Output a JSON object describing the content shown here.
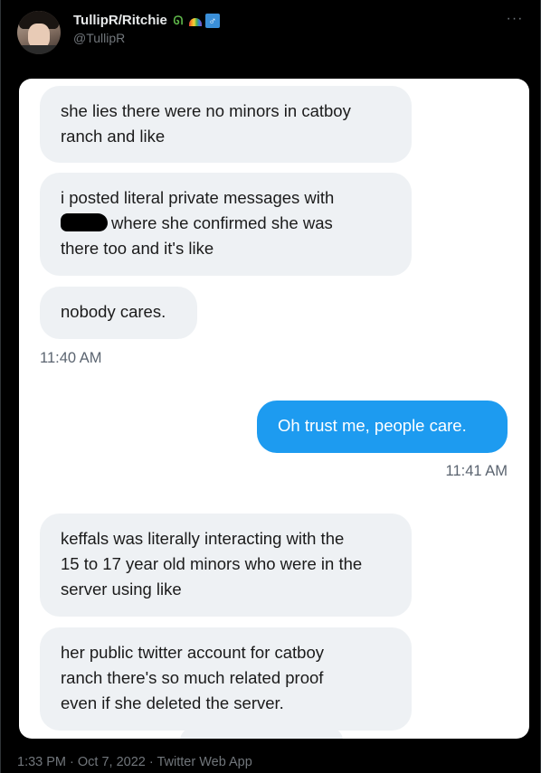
{
  "author": {
    "display_name": "TullipR/Ritchie",
    "handle": "@TullipR",
    "emojis": [
      "lizard-emoji",
      "rainbow-emoji",
      "male-sign-emoji"
    ]
  },
  "messages": [
    {
      "id": "m1",
      "text": "she lies there were no minors in catboy\nranch and like",
      "direction": "received"
    },
    {
      "id": "m2",
      "line1": "i posted literal private messages with",
      "line2_after_redaction": "where she confirmed she was",
      "line3": "there too and it's like",
      "direction": "received"
    },
    {
      "id": "m3",
      "text": "nobody cares.",
      "direction": "received"
    },
    {
      "id": "m4",
      "text": "Oh trust me, people care.",
      "direction": "sent"
    },
    {
      "id": "m5",
      "text": "keffals was literally interacting with the\n15 to 17 year old minors who were in the\nserver using like",
      "direction": "received"
    },
    {
      "id": "m6",
      "text": "her public twitter account for catboy\nranch there's so much related proof\neven if she deleted the server.",
      "direction": "received"
    }
  ],
  "timestamps": {
    "received": "11:40 AM",
    "sent": "11:41 AM"
  },
  "footer": {
    "time": "1:33 PM",
    "sep1": " · ",
    "date": "Oct 7, 2022",
    "sep2": " · ",
    "source": "Twitter Web App"
  },
  "colors": {
    "background": "#000000",
    "sent_bubble": "#1d9bf0",
    "received_bubble": "#eef1f4",
    "muted_text": "#71767b"
  }
}
